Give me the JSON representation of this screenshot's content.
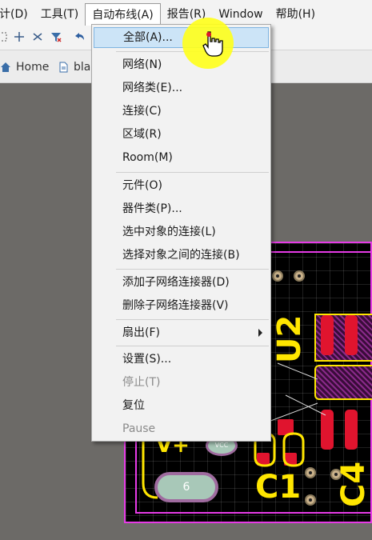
{
  "menubar": {
    "items": [
      {
        "label": "设计(D)",
        "shown": "计(D)"
      },
      {
        "label": "工具(T)"
      },
      {
        "label": "自动布线(A)"
      },
      {
        "label": "报告(R)"
      },
      {
        "label": "Window"
      },
      {
        "label": "帮助(H)"
      }
    ]
  },
  "tabs": {
    "home": "Home",
    "doc": "bla"
  },
  "autoroute_menu": {
    "items": [
      {
        "label": "全部(A)..."
      },
      {
        "label": "网络(N)"
      },
      {
        "label": "网络类(E)..."
      },
      {
        "label": "连接(C)"
      },
      {
        "label": "区域(R)"
      },
      {
        "label": "Room(M)"
      },
      {
        "label": "元件(O)"
      },
      {
        "label": "器件类(P)..."
      },
      {
        "label": "选中对象的连接(L)"
      },
      {
        "label": "选择对象之间的连接(B)"
      },
      {
        "label": "添加子网络连接器(D)"
      },
      {
        "label": "删除子网络连接器(V)"
      },
      {
        "label": "扇出(F)"
      },
      {
        "label": "设置(S)..."
      },
      {
        "label": "停止(T)"
      },
      {
        "label": "复位"
      },
      {
        "label": "Pause"
      }
    ]
  },
  "pcb": {
    "designators": [
      "U2",
      "C1",
      "C4",
      "V+"
    ],
    "pad_labels": [
      "6",
      "VCC"
    ]
  },
  "colors": {
    "highlight": "#cce4f7",
    "board_outline": "#e63be6",
    "silkscreen": "#ffe600",
    "top_copper": "#e0142e"
  }
}
